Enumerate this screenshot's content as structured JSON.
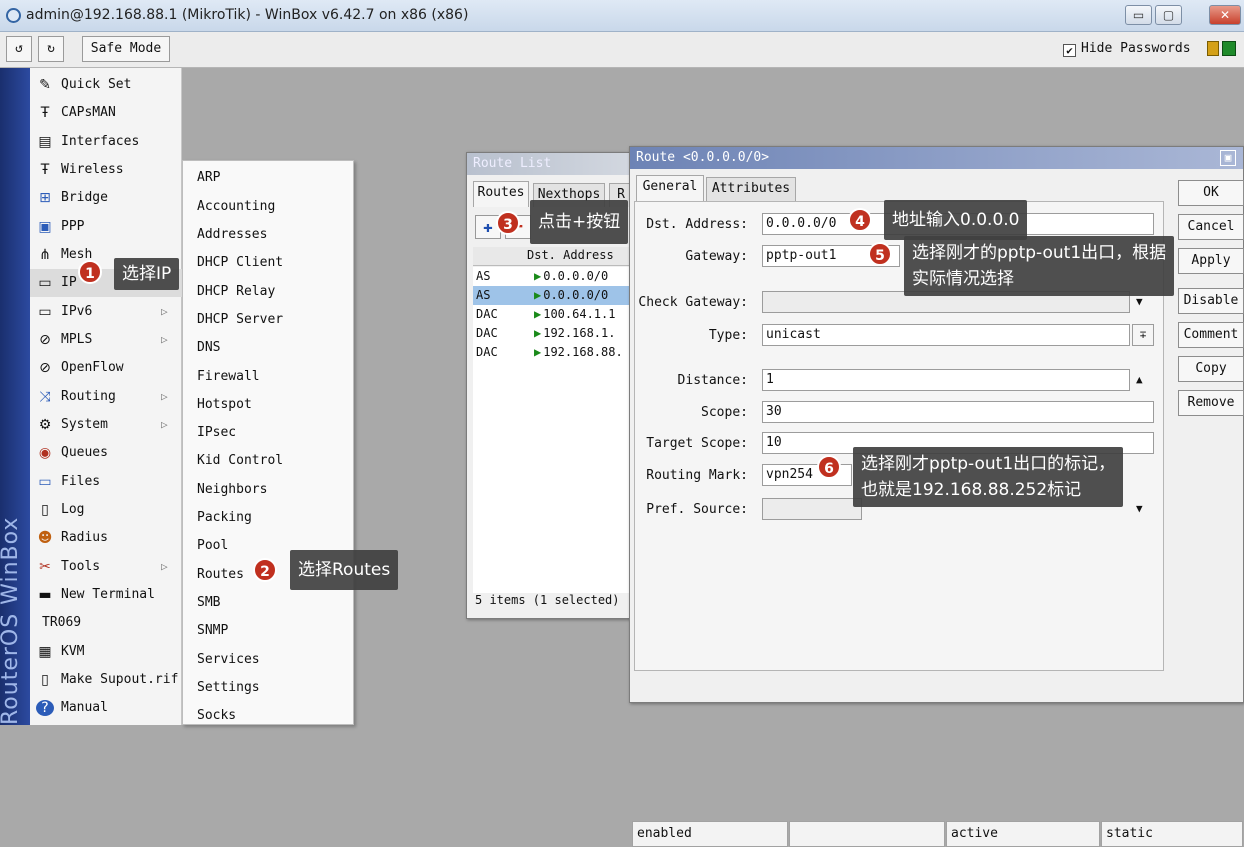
{
  "window": {
    "title": "admin@192.168.88.1 (MikroTik) - WinBox v6.42.7 on x86 (x86)",
    "min": "▭",
    "max": "▢",
    "close": "✕"
  },
  "toolbar": {
    "undo": "↺",
    "redo": "↻",
    "safe_mode": "Safe Mode",
    "hide_passwords": "Hide Passwords",
    "hide_passwords_checked": "✔"
  },
  "brand": "RouterOS WinBox",
  "menu": {
    "items": [
      {
        "label": "Quick Set",
        "icon": "✎"
      },
      {
        "label": "CAPsMAN",
        "icon": "Ŧ"
      },
      {
        "label": "Interfaces",
        "icon": "▤"
      },
      {
        "label": "Wireless",
        "icon": "Ŧ"
      },
      {
        "label": "Bridge",
        "icon": "⊞"
      },
      {
        "label": "PPP",
        "icon": "▣"
      },
      {
        "label": "Mesh",
        "icon": "⋔"
      },
      {
        "label": "IP",
        "icon": "▭"
      },
      {
        "label": "IPv6",
        "icon": "▭"
      },
      {
        "label": "MPLS",
        "icon": "⊘"
      },
      {
        "label": "OpenFlow",
        "icon": "⊘"
      },
      {
        "label": "Routing",
        "icon": "⤨"
      },
      {
        "label": "System",
        "icon": "⚙"
      },
      {
        "label": "Queues",
        "icon": "◉"
      },
      {
        "label": "Files",
        "icon": "▭"
      },
      {
        "label": "Log",
        "icon": "▯"
      },
      {
        "label": "Radius",
        "icon": "☻"
      },
      {
        "label": "Tools",
        "icon": "✂"
      },
      {
        "label": "New Terminal",
        "icon": "▬"
      },
      {
        "label": "TR069",
        "icon": ""
      },
      {
        "label": "KVM",
        "icon": "▦"
      },
      {
        "label": "Make Supout.rif",
        "icon": "▯"
      },
      {
        "label": "Manual",
        "icon": "?"
      }
    ],
    "submenu_arrow": "▷"
  },
  "ip_submenu": [
    "ARP",
    "Accounting",
    "Addresses",
    "DHCP Client",
    "DHCP Relay",
    "DHCP Server",
    "DNS",
    "Firewall",
    "Hotspot",
    "IPsec",
    "Kid Control",
    "Neighbors",
    "Packing",
    "Pool",
    "Routes",
    "SMB",
    "SNMP",
    "Services",
    "Settings",
    "Socks"
  ],
  "route_list": {
    "title": "Route List",
    "tabs": [
      "Routes",
      "Nexthops",
      "R"
    ],
    "add": "✚",
    "remove": "━",
    "col_dst": "Dst. Address",
    "flag": "▶",
    "rows": [
      {
        "type": "AS",
        "dst": "0.0.0.0/0",
        "selected": false
      },
      {
        "type": "AS",
        "dst": "0.0.0.0/0",
        "selected": true
      },
      {
        "type": "DAC",
        "dst": "100.64.1.1",
        "selected": false
      },
      {
        "type": "DAC",
        "dst": "192.168.1.",
        "selected": false
      },
      {
        "type": "DAC",
        "dst": "192.168.88.",
        "selected": false
      }
    ],
    "status": "5 items (1 selected)"
  },
  "route_dialog": {
    "title": "Route <0.0.0.0/0>",
    "restore": "▣",
    "tabs": [
      "General",
      "Attributes"
    ],
    "labels": {
      "dst": "Dst. Address:",
      "gateway": "Gateway:",
      "check_gateway": "Check Gateway:",
      "type": "Type:",
      "distance": "Distance:",
      "scope": "Scope:",
      "target_scope": "Target Scope:",
      "routing_mark": "Routing Mark:",
      "pref_source": "Pref. Source:"
    },
    "values": {
      "dst": "0.0.0.0/0",
      "gateway": "pptp-out1",
      "check_gateway": "",
      "type": "unicast",
      "distance": "1",
      "scope": "30",
      "target_scope": "10",
      "routing_mark": "vpn254",
      "pref_source": ""
    },
    "buttons": [
      "OK",
      "Cancel",
      "Apply",
      "Disable",
      "Comment",
      "Copy",
      "Remove"
    ],
    "status": {
      "s1": "enabled",
      "s2": "",
      "s3": "active",
      "s4": "static"
    },
    "down": "▼",
    "up": "▲",
    "dd": "∓"
  },
  "annotations": [
    {
      "num": "1",
      "text": "选择IP"
    },
    {
      "num": "2",
      "text": "选择Routes"
    },
    {
      "num": "3",
      "text": "点击+按钮"
    },
    {
      "num": "4",
      "text": "地址输入0.0.0.0"
    },
    {
      "num": "5",
      "text": "选择刚才的pptp-out1出口，根据",
      "text2": "实际情况选择"
    },
    {
      "num": "6",
      "text": "选择刚才pptp-out1出口的标记，",
      "text2": "也就是192.168.88.252标记"
    }
  ],
  "colors": {
    "selection": "#9ec3e8",
    "badge": "#c0301f",
    "annotation_bg": "#404040",
    "titlebar_active": "#6d83b5"
  }
}
